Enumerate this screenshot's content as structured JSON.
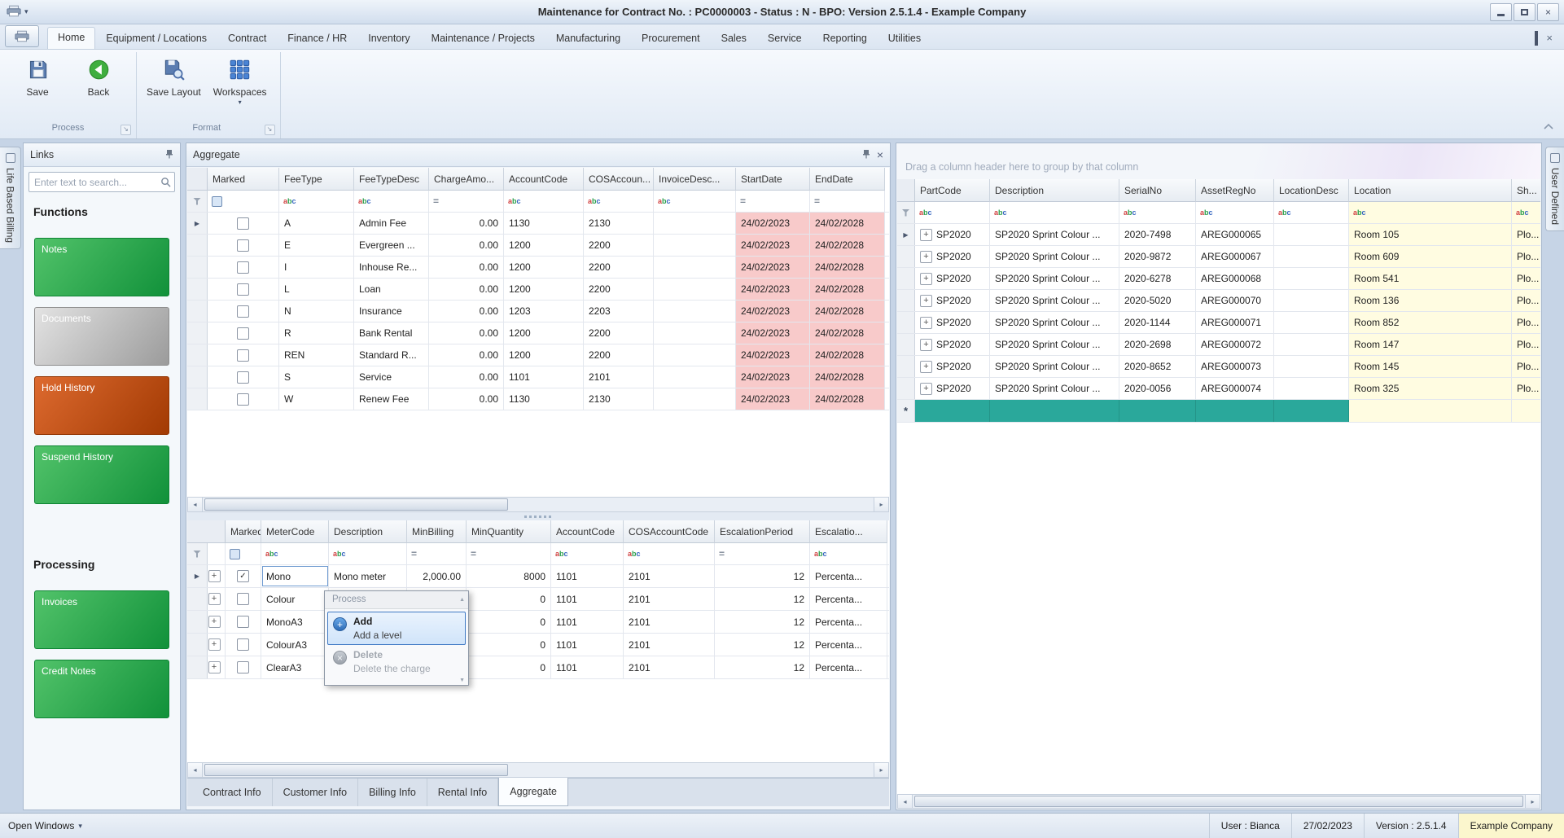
{
  "window": {
    "title": "Maintenance for Contract No. : PC0000003 - Status : N - BPO: Version 2.5.1.4 - Example Company"
  },
  "ribbon": {
    "tabs": [
      {
        "label": "Home",
        "active": true
      },
      {
        "label": "Equipment / Locations"
      },
      {
        "label": "Contract"
      },
      {
        "label": "Finance / HR"
      },
      {
        "label": "Inventory"
      },
      {
        "label": "Maintenance / Projects"
      },
      {
        "label": "Manufacturing"
      },
      {
        "label": "Procurement"
      },
      {
        "label": "Sales"
      },
      {
        "label": "Service"
      },
      {
        "label": "Reporting"
      },
      {
        "label": "Utilities"
      }
    ],
    "buttons": [
      {
        "label": "Save"
      },
      {
        "label": "Back"
      },
      {
        "label": "Save Layout"
      },
      {
        "label": "Workspaces"
      }
    ],
    "groups": [
      "Process",
      "Format"
    ]
  },
  "side_tabs": {
    "left": "Life Based Billing",
    "right": "User Defined"
  },
  "links_panel": {
    "title": "Links",
    "search_placeholder": "Enter text to search...",
    "sections": [
      {
        "heading": "Functions",
        "buttons": [
          {
            "label": "Notes",
            "color": "green"
          },
          {
            "label": "Documents",
            "color": "gray"
          },
          {
            "label": "Hold History",
            "color": "red"
          },
          {
            "label": "Suspend History",
            "color": "green"
          }
        ]
      },
      {
        "heading": "Processing",
        "buttons": [
          {
            "label": "Invoices",
            "color": "green"
          },
          {
            "label": "Credit Notes",
            "color": "green"
          }
        ]
      }
    ]
  },
  "aggregate_panel": {
    "title": "Aggregate",
    "fee_grid": {
      "columns": [
        "Marked",
        "FeeType",
        "FeeTypeDesc",
        "ChargeAmo...",
        "AccountCode",
        "COSAccoun...",
        "InvoiceDesc...",
        "StartDate",
        "EndDate"
      ],
      "rows": [
        [
          "A",
          "Admin Fee",
          "0.00",
          "1130",
          "2130",
          "",
          "24/02/2023",
          "24/02/2028"
        ],
        [
          "E",
          "Evergreen ...",
          "0.00",
          "1200",
          "2200",
          "",
          "24/02/2023",
          "24/02/2028"
        ],
        [
          "I",
          "Inhouse Re...",
          "0.00",
          "1200",
          "2200",
          "",
          "24/02/2023",
          "24/02/2028"
        ],
        [
          "L",
          "Loan",
          "0.00",
          "1200",
          "2200",
          "",
          "24/02/2023",
          "24/02/2028"
        ],
        [
          "N",
          "Insurance",
          "0.00",
          "1203",
          "2203",
          "",
          "24/02/2023",
          "24/02/2028"
        ],
        [
          "R",
          "Bank Rental",
          "0.00",
          "1200",
          "2200",
          "",
          "24/02/2023",
          "24/02/2028"
        ],
        [
          "REN",
          "Standard R...",
          "0.00",
          "1200",
          "2200",
          "",
          "24/02/2023",
          "24/02/2028"
        ],
        [
          "S",
          "Service",
          "0.00",
          "1101",
          "2101",
          "",
          "24/02/2023",
          "24/02/2028"
        ],
        [
          "W",
          "Renew Fee",
          "0.00",
          "1130",
          "2130",
          "",
          "24/02/2023",
          "24/02/2028"
        ]
      ]
    },
    "meter_grid": {
      "columns": [
        "Marked",
        "MeterCode",
        "Description",
        "MinBilling",
        "MinQuantity",
        "AccountCode",
        "COSAccountCode",
        "EscalationPeriod",
        "Escalatio..."
      ],
      "rows": [
        {
          "checked": true,
          "cells": [
            "Mono",
            "Mono meter",
            "2,000.00",
            "8000",
            "1101",
            "2101",
            "12",
            "Percenta..."
          ]
        },
        {
          "checked": false,
          "cells": [
            "Colour",
            "",
            "",
            "0",
            "1101",
            "2101",
            "12",
            "Percenta..."
          ]
        },
        {
          "checked": false,
          "cells": [
            "MonoA3",
            "",
            "",
            "0",
            "1101",
            "2101",
            "12",
            "Percenta..."
          ]
        },
        {
          "checked": false,
          "cells": [
            "ColourA3",
            "",
            "",
            "0",
            "1101",
            "2101",
            "12",
            "Percenta..."
          ]
        },
        {
          "checked": false,
          "cells": [
            "ClearA3",
            "",
            "",
            "0",
            "1101",
            "2101",
            "12",
            "Percenta..."
          ]
        }
      ]
    },
    "bottom_tabs": [
      {
        "label": "Contract Info"
      },
      {
        "label": "Customer Info"
      },
      {
        "label": "Billing Info"
      },
      {
        "label": "Rental Info"
      },
      {
        "label": "Aggregate",
        "active": true
      }
    ]
  },
  "context_menu": {
    "caption": "Process",
    "items": [
      {
        "title": "Add",
        "subtitle": "Add a level",
        "state": "selected"
      },
      {
        "title": "Delete",
        "subtitle": "Delete the charge",
        "state": "disabled"
      }
    ]
  },
  "equipment_panel": {
    "group_hint": "Drag a column header here to group by that column",
    "columns": [
      "PartCode",
      "Description",
      "SerialNo",
      "AssetRegNo",
      "LocationDesc",
      "Location",
      "Sh..."
    ],
    "rows": [
      [
        "SP2020",
        "SP2020 Sprint Colour ...",
        "2020-7498",
        "AREG000065",
        "",
        "Room 105",
        "Plo..."
      ],
      [
        "SP2020",
        "SP2020 Sprint Colour ...",
        "2020-9872",
        "AREG000067",
        "",
        "Room 609",
        "Plo..."
      ],
      [
        "SP2020",
        "SP2020 Sprint Colour ...",
        "2020-6278",
        "AREG000068",
        "",
        "Room 541",
        "Plo..."
      ],
      [
        "SP2020",
        "SP2020 Sprint Colour ...",
        "2020-5020",
        "AREG000070",
        "",
        "Room 136",
        "Plo..."
      ],
      [
        "SP2020",
        "SP2020 Sprint Colour ...",
        "2020-1144",
        "AREG000071",
        "",
        "Room 852",
        "Plo..."
      ],
      [
        "SP2020",
        "SP2020 Sprint Colour ...",
        "2020-2698",
        "AREG000072",
        "",
        "Room 147",
        "Plo..."
      ],
      [
        "SP2020",
        "SP2020 Sprint Colour ...",
        "2020-8652",
        "AREG000073",
        "",
        "Room 145",
        "Plo..."
      ],
      [
        "SP2020",
        "SP2020 Sprint Colour ...",
        "2020-0056",
        "AREG000074",
        "",
        "Room 325",
        "Plo..."
      ]
    ],
    "new_row_marker": "*"
  },
  "status_bar": {
    "open_windows": "Open Windows",
    "user": "User : Bianca",
    "date": "27/02/2023",
    "version": "Version : 2.5.1.4",
    "company": "Example Company"
  },
  "colors": {
    "green_button": "#11913a",
    "red_button": "#a23a03",
    "teal_new_row": "#2aa89b",
    "date_cell_bg": "#f8caca",
    "location_cell_bg": "#fffce1"
  }
}
